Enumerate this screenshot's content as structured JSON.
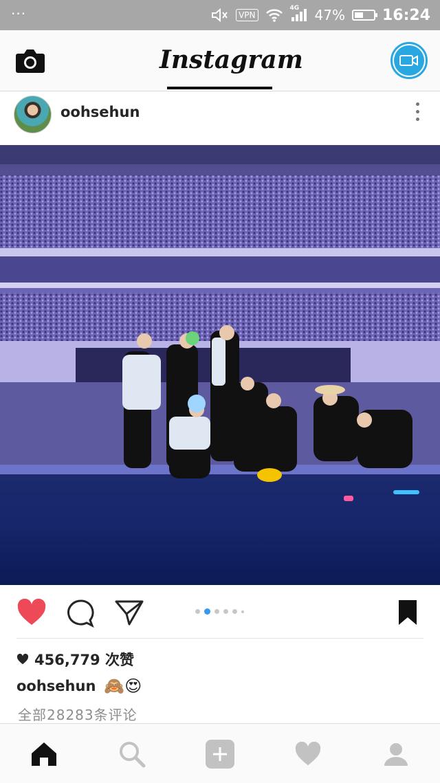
{
  "status_bar": {
    "dots": "···",
    "vpn": "VPN",
    "network": "4G",
    "battery_pct": "47%",
    "battery_level": 0.47,
    "time": "16:24"
  },
  "header": {
    "brand": "Instagram",
    "camera_icon": "camera-icon",
    "live_icon": "video-camera-icon",
    "accent_color": "#29a7e0"
  },
  "post": {
    "username": "oohsehun",
    "menu_icon": "more-vertical-icon",
    "carousel": {
      "count": 6,
      "active_index": 1
    },
    "actions": {
      "like_icon": "heart-filled-icon",
      "comment_icon": "comment-icon",
      "share_icon": "send-icon",
      "save_icon": "bookmark-icon",
      "like_color": "#ed4956"
    },
    "likes_text": "456,779 次赞",
    "caption_user": "oohsehun",
    "caption_emojis": "🙈😍",
    "comments_link": "全部28283条评论"
  },
  "bottom_nav": {
    "items": [
      "home-icon",
      "search-icon",
      "add-icon",
      "heart-icon",
      "profile-icon"
    ],
    "active": "home-icon"
  }
}
